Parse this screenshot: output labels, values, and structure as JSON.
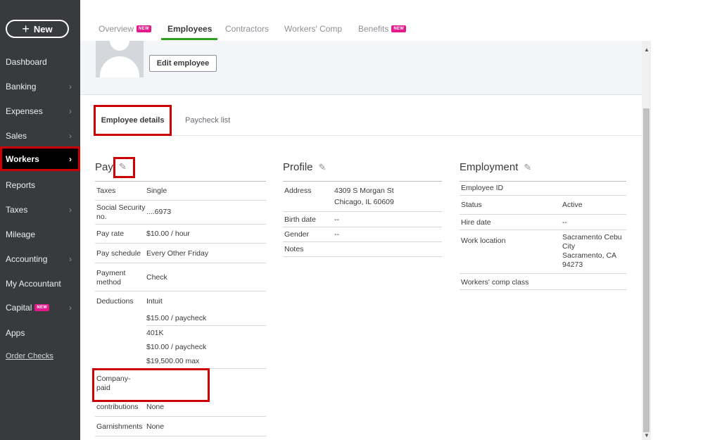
{
  "sidebar": {
    "new_label": "New",
    "items": [
      {
        "label": "Dashboard",
        "chevron": false
      },
      {
        "label": "Banking",
        "chevron": true
      },
      {
        "label": "Expenses",
        "chevron": true
      },
      {
        "label": "Sales",
        "chevron": true
      },
      {
        "label": "Workers",
        "chevron": true,
        "active": true
      },
      {
        "label": "Reports",
        "chevron": false
      },
      {
        "label": "Taxes",
        "chevron": true
      },
      {
        "label": "Mileage",
        "chevron": false
      },
      {
        "label": "Accounting",
        "chevron": true
      },
      {
        "label": "My Accountant",
        "chevron": false
      },
      {
        "label": "Capital",
        "chevron": true,
        "badge": "NEW"
      },
      {
        "label": "Apps",
        "chevron": false
      }
    ],
    "order_checks": "Order Checks"
  },
  "top_tabs": [
    {
      "label": "Overview",
      "badge": "NEW"
    },
    {
      "label": "Employees",
      "active": true
    },
    {
      "label": "Contractors"
    },
    {
      "label": "Workers' Comp"
    },
    {
      "label": "Benefits",
      "badge": "NEW"
    }
  ],
  "header": {
    "edit_employee": "Edit employee"
  },
  "sub_tabs": {
    "details": "Employee details",
    "paycheck": "Paycheck list"
  },
  "pay": {
    "title": "Pay",
    "taxes_label": "Taxes",
    "taxes_value": "Single",
    "ssn_label_1": "Social Security",
    "ssn_label_2": "no.",
    "ssn_value": "....6973",
    "rate_label": "Pay rate",
    "rate_value": "$10.00 / hour",
    "schedule_label": "Pay schedule",
    "schedule_value": "Every Other Friday",
    "method_label_1": "Payment",
    "method_label_2": "method",
    "method_value": "Check",
    "deductions_label": "Deductions",
    "deduction_1_name": "Intuit",
    "deduction_1_amount": "$15.00 / paycheck",
    "deduction_2_name": "401K",
    "deduction_2_amount": "$10.00 / paycheck",
    "deduction_2_max": "$19,500.00 max",
    "company_paid_1": "Company-",
    "company_paid_2": "paid",
    "contributions_label": "contributions",
    "contributions_value": "None",
    "garnishments_label": "Garnishments",
    "garnishments_value": "None"
  },
  "profile": {
    "title": "Profile",
    "address_label": "Address",
    "address_line1": "4309 S Morgan St",
    "address_line2": "Chicago, IL 60609",
    "birth_label": "Birth date",
    "birth_value": "--",
    "gender_label": "Gender",
    "gender_value": "--",
    "notes_label": "Notes"
  },
  "employment": {
    "title": "Employment",
    "id_label": "Employee ID",
    "status_label": "Status",
    "status_value": "Active",
    "hire_label": "Hire date",
    "hire_value": "--",
    "location_label": "Work location",
    "location_line1": "Sacramento Cebu",
    "location_line2": "City",
    "location_line3": "Sacramento, CA",
    "location_line4": "94273",
    "comp_label": "Workers' comp class"
  },
  "colors": {
    "sidebar_bg": "#393a3d",
    "accent_green": "#2ca01c",
    "highlight_red": "#cc0000",
    "badge_pink": "#e5198b"
  }
}
